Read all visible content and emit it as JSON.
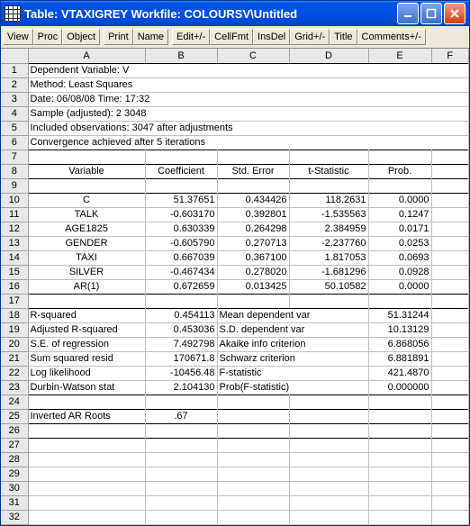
{
  "window": {
    "title": "Table: VTAXIGREY   Workfile: COLOURSV\\Untitled"
  },
  "toolbar": {
    "g1": [
      "View",
      "Proc",
      "Object"
    ],
    "g2": [
      "Print",
      "Name"
    ],
    "g3": [
      "Edit+/-",
      "CellFmt",
      "InsDel",
      "Grid+/-",
      "Title",
      "Comments+/-"
    ]
  },
  "columns": [
    "",
    "A",
    "B",
    "C",
    "D",
    "E",
    "F"
  ],
  "rows": [
    {
      "n": 1,
      "a": "Dependent Variable: V"
    },
    {
      "n": 2,
      "a": "Method: Least Squares"
    },
    {
      "n": 3,
      "a": "Date: 06/08/08   Time: 17:32"
    },
    {
      "n": 4,
      "a": "Sample (adjusted): 2 3048"
    },
    {
      "n": 5,
      "a": "Included observations: 3047 after adjustments"
    },
    {
      "n": 6,
      "a": "Convergence achieved after 5 iterations"
    }
  ],
  "headers": {
    "n": 8,
    "a": "Variable",
    "b": "Coefficient",
    "c": "Std. Error",
    "d": "t-Statistic",
    "e": "Prob."
  },
  "empty7": 7,
  "empty9": 9,
  "coeffs": [
    {
      "n": 10,
      "a": "C",
      "b": "51.37651",
      "c": "0.434426",
      "d": "118.2631",
      "e": "0.0000"
    },
    {
      "n": 11,
      "a": "TALK",
      "b": "-0.603170",
      "c": "0.392801",
      "d": "-1.535563",
      "e": "0.1247"
    },
    {
      "n": 12,
      "a": "AGE1825",
      "b": "0.630339",
      "c": "0.264298",
      "d": "2.384959",
      "e": "0.0171"
    },
    {
      "n": 13,
      "a": "GENDER",
      "b": "-0.605790",
      "c": "0.270713",
      "d": "-2.237760",
      "e": "0.0253"
    },
    {
      "n": 14,
      "a": "TAXI",
      "b": "0.667039",
      "c": "0.367100",
      "d": "1.817053",
      "e": "0.0693"
    },
    {
      "n": 15,
      "a": "SILVER",
      "b": "-0.467434",
      "c": "0.278020",
      "d": "-1.681296",
      "e": "0.0928"
    },
    {
      "n": 16,
      "a": "AR(1)",
      "b": "0.672659",
      "c": "0.013425",
      "d": "50.10582",
      "e": "0.0000"
    }
  ],
  "empty17": 17,
  "stats": [
    {
      "n": 18,
      "a": "R-squared",
      "b": "0.454113",
      "c": "Mean dependent var",
      "e": "51.31244"
    },
    {
      "n": 19,
      "a": "Adjusted R-squared",
      "b": "0.453036",
      "c": "S.D. dependent var",
      "e": "10.13129"
    },
    {
      "n": 20,
      "a": "S.E. of regression",
      "b": "7.492798",
      "c": "Akaike info criterion",
      "e": "6.868056"
    },
    {
      "n": 21,
      "a": "Sum squared resid",
      "b": "170671.8",
      "c": "Schwarz criterion",
      "e": "6.881891"
    },
    {
      "n": 22,
      "a": "Log likelihood",
      "b": "-10456.48",
      "c": "F-statistic",
      "e": "421.4870"
    },
    {
      "n": 23,
      "a": "Durbin-Watson stat",
      "b": "2.104130",
      "c": "Prob(F-statistic)",
      "e": "0.000000"
    }
  ],
  "empty24": 24,
  "roots": {
    "n": 25,
    "a": "Inverted AR Roots",
    "b": ".67"
  },
  "empties": [
    26,
    27,
    28,
    29,
    30,
    31,
    32
  ]
}
